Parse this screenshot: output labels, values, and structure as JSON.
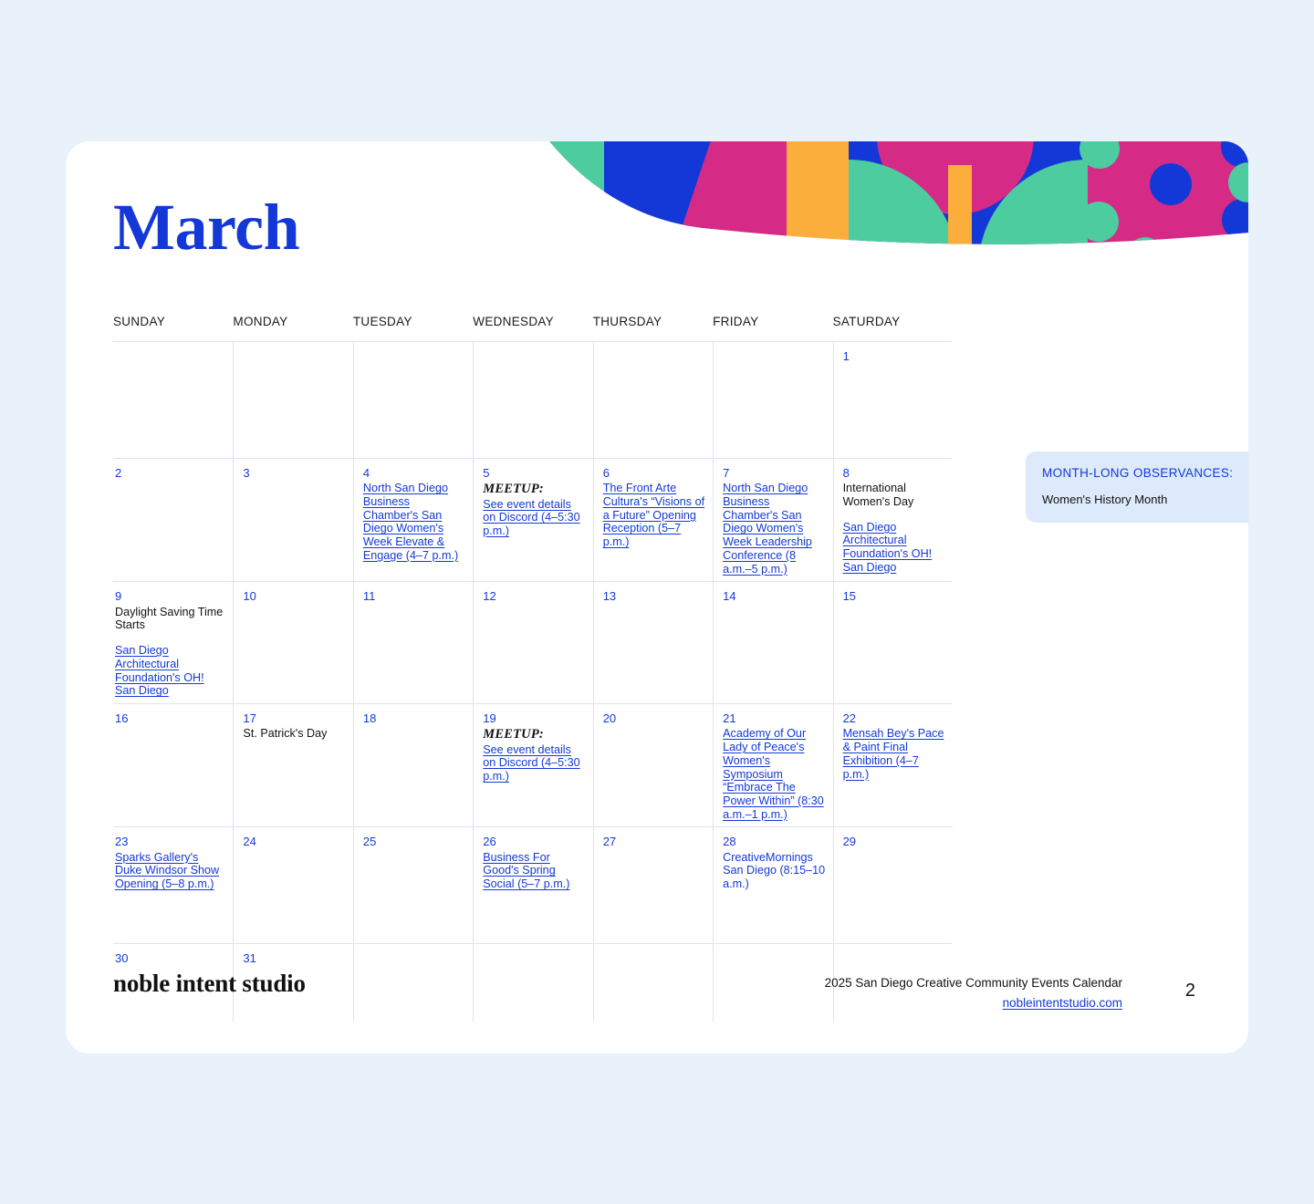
{
  "theme": {
    "page_background": "#e9f1fb",
    "card_background": "#ffffff",
    "accent_blue": "#1438d8",
    "grid_line": "#d8e6f8",
    "observance_background": "#ddeafb",
    "deco_blue": "#1438d8",
    "deco_pink": "#d62a87",
    "deco_green": "#4dcca0",
    "deco_orange": "#fbae3c"
  },
  "header": {
    "month_title": "March"
  },
  "weekdays": [
    "SUNDAY",
    "MONDAY",
    "TUESDAY",
    "WEDNESDAY",
    "THURSDAY",
    "FRIDAY",
    "SATURDAY"
  ],
  "observances": {
    "title": "MONTH-LONG OBSERVANCES:",
    "items": [
      "Women's History Month"
    ]
  },
  "footer": {
    "logo": "noble intent studio",
    "calendar_name": "2025 San Diego Creative Community Events Calendar",
    "website": "nobleintentstudio.com",
    "page_number": "2"
  },
  "weeks": [
    [
      {
        "day": ""
      },
      {
        "day": ""
      },
      {
        "day": ""
      },
      {
        "day": ""
      },
      {
        "day": ""
      },
      {
        "day": ""
      },
      {
        "day": "1"
      }
    ],
    [
      {
        "day": "2"
      },
      {
        "day": "3"
      },
      {
        "day": "4",
        "events": [
          {
            "style": "link",
            "text": "North San Diego Business Chamber's San Diego Women's Week Elevate & Engage (4–7 p.m.)"
          }
        ]
      },
      {
        "day": "5",
        "events": [
          {
            "style": "meetup",
            "text": "MEETUP:"
          },
          {
            "style": "link",
            "text": "See event details on Discord (4–5:30 p.m.)"
          }
        ]
      },
      {
        "day": "6",
        "events": [
          {
            "style": "link",
            "text": "The Front Arte Cultura's “Visions of a Future” Opening Reception (5–7 p.m.)"
          }
        ]
      },
      {
        "day": "7",
        "events": [
          {
            "style": "link",
            "text": "North San Diego Business Chamber's San Diego Women's Week Leadership Conference (8 a.m.–5 p.m.)"
          }
        ]
      },
      {
        "day": "8",
        "events": [
          {
            "style": "black",
            "text": "International Women's Day"
          },
          {
            "style": "link gap",
            "text": "San Diego Architectural Foundation's OH! San Diego"
          }
        ]
      }
    ],
    [
      {
        "day": "9",
        "events": [
          {
            "style": "black",
            "text": "Daylight Saving Time Starts"
          },
          {
            "style": "link gap",
            "text": "San Diego Architectural Foundation's OH! San Diego"
          }
        ]
      },
      {
        "day": "10"
      },
      {
        "day": "11"
      },
      {
        "day": "12"
      },
      {
        "day": "13"
      },
      {
        "day": "14"
      },
      {
        "day": "15"
      }
    ],
    [
      {
        "day": "16"
      },
      {
        "day": "17",
        "events": [
          {
            "style": "black",
            "text": "St. Patrick's Day"
          }
        ]
      },
      {
        "day": "18"
      },
      {
        "day": "19",
        "events": [
          {
            "style": "meetup",
            "text": "MEETUP:"
          },
          {
            "style": "link",
            "text": "See event details on Discord (4–5:30 p.m.)"
          }
        ]
      },
      {
        "day": "20"
      },
      {
        "day": "21",
        "events": [
          {
            "style": "link",
            "text": "Academy of Our Lady of Peace's Women's Symposium “Embrace The Power Within” (8:30 a.m.–1 p.m.)"
          }
        ]
      },
      {
        "day": "22",
        "events": [
          {
            "style": "link",
            "text": "Mensah Bey's Pace & Paint Final Exhibition (4–7 p.m.)"
          }
        ]
      }
    ],
    [
      {
        "day": "23",
        "events": [
          {
            "style": "link",
            "text": "Sparks Gallery's Duke Windsor Show Opening (5–8 p.m.)"
          }
        ]
      },
      {
        "day": "24"
      },
      {
        "day": "25"
      },
      {
        "day": "26",
        "events": [
          {
            "style": "link",
            "text": "Business For Good's Spring Social (5–7 p.m.)"
          }
        ]
      },
      {
        "day": "27"
      },
      {
        "day": "28",
        "events": [
          {
            "style": "plain",
            "text": "CreativeMornings San Diego (8:15–10 a.m.)"
          }
        ]
      },
      {
        "day": "29"
      }
    ],
    [
      {
        "day": "30"
      },
      {
        "day": "31"
      },
      {
        "day": ""
      },
      {
        "day": ""
      },
      {
        "day": ""
      },
      {
        "day": ""
      },
      {
        "day": ""
      }
    ]
  ]
}
